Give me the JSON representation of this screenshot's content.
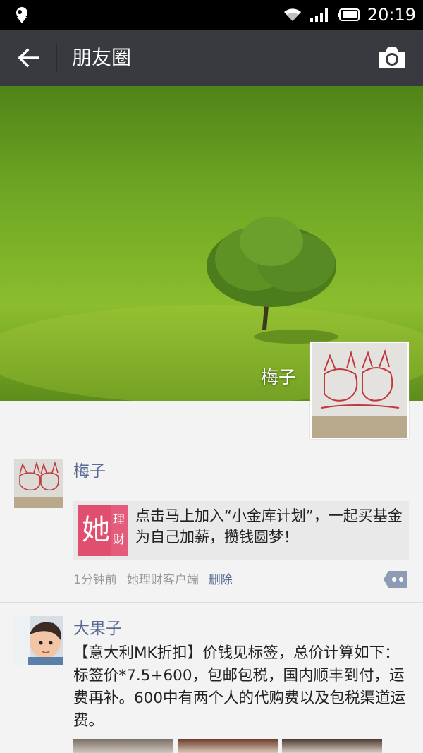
{
  "status_bar": {
    "time": "20:19",
    "icons": [
      "notification-icon",
      "wifi-icon",
      "signal-icon",
      "battery-icon"
    ]
  },
  "header": {
    "title": "朋友圈",
    "back_icon": "arrow-left-icon",
    "camera_icon": "camera-icon"
  },
  "cover": {
    "user_name": "梅子"
  },
  "posts": [
    {
      "name": "梅子",
      "share": {
        "thumb_char_main": "她",
        "thumb_char_1": "理",
        "thumb_char_2": "财",
        "text": "点击马上加入“小金库计划”，一起买基金为自己加薪，攒钱圆梦！"
      },
      "time": "1分钟前",
      "source": "她理财客户端",
      "delete_label": "删除"
    },
    {
      "name": "大果子",
      "text": "【意大利MK折扣】价钱见标签，总价计算如下：标签价*7.5+600，包邮包税，国内顺丰到付，运费再补。600中有两个人的代购费以及包税渠道运费。"
    }
  ],
  "colors": {
    "title_bar": "#393a3f",
    "name_link": "#576b95",
    "background": "#f3f3f3"
  }
}
